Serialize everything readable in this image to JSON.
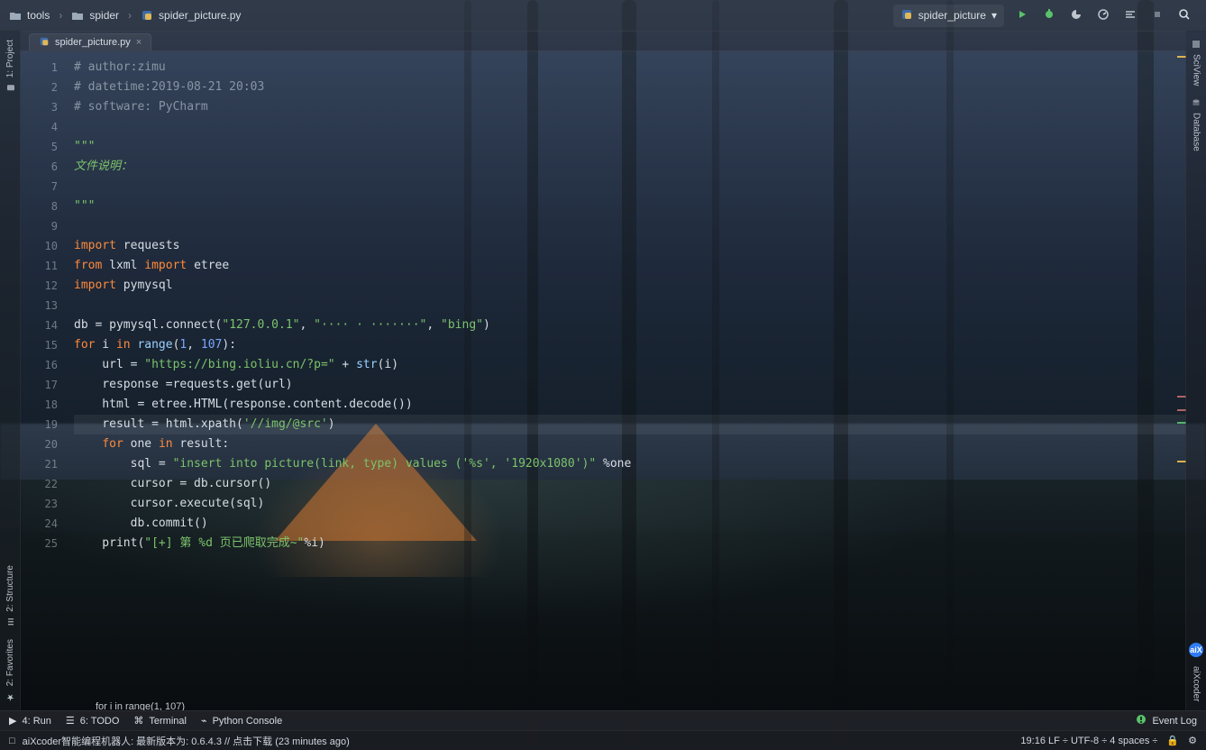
{
  "topbar": {
    "crumbs": [
      {
        "label": "tools",
        "icon": "folder-icon"
      },
      {
        "label": "spider",
        "icon": "folder-icon"
      },
      {
        "label": "spider_picture.py",
        "icon": "python-file-icon"
      }
    ],
    "run_config": {
      "label": "spider_picture",
      "icon": "python-run-config-icon"
    },
    "tools": [
      {
        "name": "run-icon"
      },
      {
        "name": "debug-icon"
      },
      {
        "name": "coverage-icon"
      },
      {
        "name": "profile-icon"
      },
      {
        "name": "build-icon"
      },
      {
        "name": "stop-icon"
      },
      {
        "name": "search-icon"
      }
    ]
  },
  "left_strip": {
    "top": "1: Project",
    "bottom1": "2: Structure",
    "bottom2": "2: Favorites"
  },
  "right_strip": {
    "top1": "SciView",
    "top2": "Database",
    "bottom": "aiXcoder",
    "bubble": "aiX"
  },
  "editor": {
    "tab_label": "spider_picture.py",
    "close_glyph": "×",
    "current_context": "for i in range(1, 107)",
    "active_line": 19,
    "gutter": [
      "1",
      "2",
      "3",
      "4",
      "5",
      "6",
      "7",
      "8",
      "9",
      "10",
      "11",
      "12",
      "13",
      "14",
      "15",
      "16",
      "17",
      "18",
      "19",
      "20",
      "21",
      "22",
      "23",
      "24",
      "25"
    ],
    "lines": [
      {
        "t": "comment",
        "text": "# author:zimu"
      },
      {
        "t": "comment",
        "text": "# datetime:2019-08-21 20:03"
      },
      {
        "t": "comment",
        "text": "# software: PyCharm"
      },
      {
        "t": "blank",
        "text": ""
      },
      {
        "t": "doc",
        "text": "\"\"\""
      },
      {
        "t": "doc",
        "text": "文件说明："
      },
      {
        "t": "blank",
        "text": ""
      },
      {
        "t": "doc",
        "text": "\"\"\""
      },
      {
        "t": "blank",
        "text": ""
      },
      {
        "t": "import",
        "parts": [
          {
            "k": "kw",
            "v": "import"
          },
          {
            "k": "txt",
            "v": " requests"
          }
        ]
      },
      {
        "t": "import",
        "parts": [
          {
            "k": "kw",
            "v": "from"
          },
          {
            "k": "txt",
            "v": " lxml "
          },
          {
            "k": "kw",
            "v": "import"
          },
          {
            "k": "txt",
            "v": " etree"
          }
        ]
      },
      {
        "t": "import",
        "parts": [
          {
            "k": "kw",
            "v": "import"
          },
          {
            "k": "txt",
            "v": " pymysql"
          }
        ]
      },
      {
        "t": "blank",
        "text": ""
      },
      {
        "t": "code",
        "parts": [
          {
            "k": "txt",
            "v": "db = pymysql.connect("
          },
          {
            "k": "str",
            "v": "\"127.0.0.1\""
          },
          {
            "k": "txt",
            "v": ", "
          },
          {
            "k": "str",
            "v": "\"···· · ·······\""
          },
          {
            "k": "txt",
            "v": ", "
          },
          {
            "k": "str",
            "v": "\"bing\""
          },
          {
            "k": "txt",
            "v": ")"
          }
        ]
      },
      {
        "t": "code",
        "parts": [
          {
            "k": "kw",
            "v": "for"
          },
          {
            "k": "txt",
            "v": " i "
          },
          {
            "k": "kw",
            "v": "in"
          },
          {
            "k": "txt",
            "v": " "
          },
          {
            "k": "fn",
            "v": "range"
          },
          {
            "k": "txt",
            "v": "("
          },
          {
            "k": "num",
            "v": "1"
          },
          {
            "k": "txt",
            "v": ", "
          },
          {
            "k": "num",
            "v": "107"
          },
          {
            "k": "txt",
            "v": "):"
          }
        ]
      },
      {
        "t": "code",
        "parts": [
          {
            "k": "txt",
            "v": "    url = "
          },
          {
            "k": "str",
            "v": "\"https://bing.ioliu.cn/?p=\""
          },
          {
            "k": "txt",
            "v": " + "
          },
          {
            "k": "fn",
            "v": "str"
          },
          {
            "k": "txt",
            "v": "(i)"
          }
        ]
      },
      {
        "t": "code",
        "parts": [
          {
            "k": "txt",
            "v": "    response =requests.get(url)"
          }
        ]
      },
      {
        "t": "code",
        "parts": [
          {
            "k": "txt",
            "v": "    html = etree.HTML(response.content.decode())"
          }
        ]
      },
      {
        "t": "code",
        "parts": [
          {
            "k": "txt",
            "v": "    result = html.xpath("
          },
          {
            "k": "str",
            "v": "'//img/@src'"
          },
          {
            "k": "txt",
            "v": ")"
          }
        ]
      },
      {
        "t": "code",
        "parts": [
          {
            "k": "txt",
            "v": "    "
          },
          {
            "k": "kw",
            "v": "for"
          },
          {
            "k": "txt",
            "v": " one "
          },
          {
            "k": "kw",
            "v": "in"
          },
          {
            "k": "txt",
            "v": " result:"
          }
        ]
      },
      {
        "t": "code",
        "parts": [
          {
            "k": "txt",
            "v": "        sql = "
          },
          {
            "k": "str",
            "v": "\"insert into picture(link, type) values ('%s', '1920x1080')\""
          },
          {
            "k": "txt",
            "v": " %one"
          }
        ]
      },
      {
        "t": "code",
        "parts": [
          {
            "k": "txt",
            "v": "        cursor = db.cursor()"
          }
        ]
      },
      {
        "t": "code",
        "parts": [
          {
            "k": "txt",
            "v": "        cursor.execute(sql)"
          }
        ]
      },
      {
        "t": "code",
        "parts": [
          {
            "k": "txt",
            "v": "        db.commit()"
          }
        ]
      },
      {
        "t": "code",
        "parts": [
          {
            "k": "txt",
            "v": "    print("
          },
          {
            "k": "str",
            "v": "\"[+] 第 %d 页已爬取完成~\""
          },
          {
            "k": "txt",
            "v": "%i)"
          }
        ]
      }
    ]
  },
  "bottom_tools": {
    "items": [
      {
        "label": "4: Run",
        "icon": "run-tool-icon"
      },
      {
        "label": "6: TODO",
        "icon": "todo-icon"
      },
      {
        "label": "Terminal",
        "icon": "terminal-icon"
      },
      {
        "label": "Python Console",
        "icon": "python-console-icon"
      }
    ],
    "event_log": "Event Log"
  },
  "statusbar": {
    "left": "aiXcoder智能编程机器人: 最新版本为: 0.6.4.3 // 点击下载 (23 minutes ago)",
    "right": "19:16   LF ÷   UTF-8 ÷   4 spaces ÷"
  }
}
